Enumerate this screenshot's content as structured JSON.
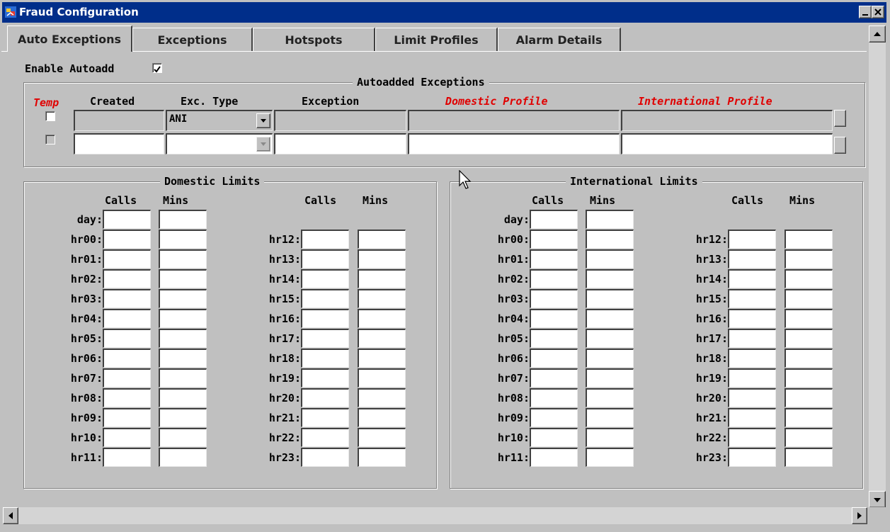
{
  "window": {
    "title": "Fraud Configuration"
  },
  "tabs": [
    {
      "label": "Auto Exceptions",
      "active": true
    },
    {
      "label": "Exceptions"
    },
    {
      "label": "Hotspots"
    },
    {
      "label": "Limit Profiles"
    },
    {
      "label": "Alarm Details"
    }
  ],
  "enable_autoadd": {
    "label": "Enable Autoadd",
    "checked": true
  },
  "autoadded": {
    "legend": "Autoadded Exceptions",
    "headers": {
      "temp": "Temp",
      "created": "Created",
      "exc_type": "Exc. Type",
      "exception": "Exception",
      "domestic_profile": "Domestic Profile",
      "international_profile": "International Profile"
    },
    "rows": [
      {
        "temp": false,
        "created": "",
        "exc_type": "ANI",
        "exception": "",
        "domestic_profile": "",
        "international_profile": ""
      },
      {
        "temp": false,
        "created": "",
        "exc_type": "",
        "exception": "",
        "domestic_profile": "",
        "international_profile": ""
      }
    ]
  },
  "domestic": {
    "legend": "Domestic Limits",
    "calls_label": "Calls",
    "mins_label": "Mins",
    "day_label": "day:",
    "left_hours": [
      "hr00:",
      "hr01:",
      "hr02:",
      "hr03:",
      "hr04:",
      "hr05:",
      "hr06:",
      "hr07:",
      "hr08:",
      "hr09:",
      "hr10:",
      "hr11:"
    ],
    "right_hours": [
      "hr12:",
      "hr13:",
      "hr14:",
      "hr15:",
      "hr16:",
      "hr17:",
      "hr18:",
      "hr19:",
      "hr20:",
      "hr21:",
      "hr22:",
      "hr23:"
    ]
  },
  "international": {
    "legend": "International Limits",
    "calls_label": "Calls",
    "mins_label": "Mins",
    "day_label": "day:",
    "left_hours": [
      "hr00:",
      "hr01:",
      "hr02:",
      "hr03:",
      "hr04:",
      "hr05:",
      "hr06:",
      "hr07:",
      "hr08:",
      "hr09:",
      "hr10:",
      "hr11:"
    ],
    "right_hours": [
      "hr12:",
      "hr13:",
      "hr14:",
      "hr15:",
      "hr16:",
      "hr17:",
      "hr18:",
      "hr19:",
      "hr20:",
      "hr21:",
      "hr22:",
      "hr23:"
    ]
  },
  "icons": {
    "app": "fraud-app-icon",
    "minimize": "minimize-icon",
    "close": "close-icon",
    "cursor": "mouse-pointer-icon"
  },
  "colors": {
    "titlebar": "#002e8a",
    "face": "#c0c0c0",
    "required_header": "#e00000"
  }
}
